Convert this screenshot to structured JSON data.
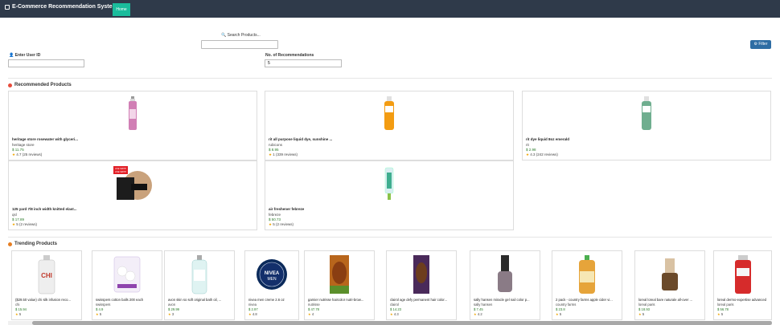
{
  "app": {
    "title": "E-Commerce Recommendation System",
    "home_label": "Home"
  },
  "search": {
    "label": "Search Products...",
    "value": ""
  },
  "filter": {
    "label": "Filter"
  },
  "user": {
    "label": "Enter User ID",
    "value": ""
  },
  "num": {
    "label": "No. of Recommendations",
    "value": "5"
  },
  "recommended": {
    "title": "Recommended Products",
    "items": [
      {
        "name": "heritage store rosewater with glyceri...",
        "brand": "heritage store",
        "price": "11.75",
        "rating": "4.7 (25 reviews)"
      },
      {
        "name": "rit all purpose liquid dye, sunshine ...",
        "brand": "rubicons",
        "price": "8.95",
        "rating": "1 (339 reviews)"
      },
      {
        "name": "rit dye liquid 8oz emerald",
        "brand": "rit",
        "price": "2.98",
        "rating": "4.3 (242 reviews)"
      },
      {
        "name": "125 yard 7/8 inch width knitted elast...",
        "brand": "qsl",
        "price": "17.89",
        "rating": "5 (2 reviews)"
      },
      {
        "name": "air freshener febreze",
        "brand": "febreze",
        "price": "50.73",
        "rating": "5 (2 reviews)"
      }
    ]
  },
  "trending": {
    "title": "Trending Products",
    "items": [
      {
        "name": "($29.50 value) chi silk infusion reco...",
        "brand": "chi",
        "price": "15.94",
        "rating": "5"
      },
      {
        "name": "swisspers cotton balls 200 each",
        "brand": "swisspers",
        "price": "4.9",
        "rating": "5"
      },
      {
        "name": "avon skin so soft original bath oil, ...",
        "brand": "avon",
        "price": "29.99",
        "rating": "3"
      },
      {
        "name": "nivea men creme 2.6 oz",
        "brand": "nivea",
        "price": "2.97",
        "rating": "4.8"
      },
      {
        "name": "garnier nutrisse haircolor nutri-brow...",
        "brand": "nutrisse",
        "price": "47.78",
        "rating": "4"
      },
      {
        "name": "clairol age defy permanent hair color...",
        "brand": "clairol",
        "price": "14.23",
        "rating": "4.3"
      },
      {
        "name": "sally hansen miracle gel nail color p...",
        "brand": "sally hansen",
        "price": "7.45",
        "rating": "4.2"
      },
      {
        "name": "2 pack - country farms apple cider vi...",
        "brand": "country farms",
        "price": "23.8",
        "rating": "5"
      },
      {
        "name": "loreal loreal bare naturale all-over ...",
        "brand": "loreal paris",
        "price": "18.93",
        "rating": "5"
      },
      {
        "name": "loreal dermo-expertise advanced",
        "brand": "loreal paris",
        "price": "56.78",
        "rating": "5"
      }
    ]
  },
  "badge": {
    "line1": "LIKE SMITH",
    "line2": "LINE SMITH"
  },
  "nivea_logo": {
    "line1": "NIVEA",
    "line2": "MEN"
  },
  "chi_logo": "CHI",
  "colors": {
    "navbar": "#2f3a4a",
    "home": "#1abc9c",
    "filter": "#2e6da4",
    "price": "#2a7a2a",
    "star": "#f0a500"
  }
}
